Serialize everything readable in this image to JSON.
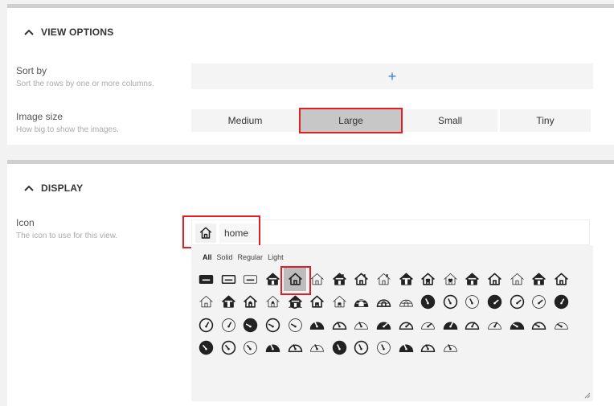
{
  "view_options": {
    "title": "VIEW OPTIONS",
    "sort_by": {
      "label": "Sort by",
      "help": "Sort the rows by one or more columns.",
      "add_label": "+"
    },
    "image_size": {
      "label": "Image size",
      "help": "How big to show the images.",
      "options": [
        "Medium",
        "Large",
        "Small",
        "Tiny"
      ],
      "selected": "Large"
    }
  },
  "display": {
    "title": "DISPLAY",
    "icon": {
      "label": "Icon",
      "help": "The icon to use for this view.",
      "value": "home",
      "preview_icon": "house-outline-icon"
    },
    "picker": {
      "filters": [
        "All",
        "Solid",
        "Regular",
        "Light"
      ],
      "active_filter": "All",
      "icons": [
        "keyboard-solid-icon",
        "keyboard-regular-icon",
        "keyboard-light-icon",
        "house-solid-icon",
        "house-regular-icon",
        "house-light-icon",
        "house-chimney-solid-icon",
        "house-chimney-regular-icon",
        "house-chimney-light-icon",
        "house-window-solid-icon",
        "house-heart-regular-icon",
        "house-heart-light-icon",
        "house-door-solid-icon",
        "house-door-regular-icon",
        "house-door-light-icon",
        "house-roof-solid-icon",
        "house-building-regular-icon",
        "house-building-light-icon",
        "house-user-solid-icon",
        "house-user-regular-icon",
        "house-user-light-icon",
        "house-flood-solid-icon",
        "house-lock-regular-icon",
        "house-lock-light-icon",
        "igloo-solid-icon",
        "igloo-regular-icon",
        "igloo-light-icon",
        "gauge-solid-icon",
        "gauge-regular-icon",
        "gauge-light-icon",
        "gauge-max-solid-icon",
        "gauge-max-regular-icon",
        "gauge-max-light-icon",
        "gauge-high-solid-icon",
        "gauge-high-regular-icon",
        "gauge-high-light-icon",
        "gauge-min-solid-icon",
        "gauge-min-regular-icon",
        "gauge-min-light-icon",
        "gauge-simple-solid-icon",
        "gauge-simple-regular-icon",
        "gauge-simple-light-icon",
        "gauge-simple-max-solid-icon",
        "gauge-simple-max-regular-icon",
        "gauge-simple-max-light-icon",
        "gauge-simple-high-solid-icon",
        "gauge-simple-high-regular-icon",
        "gauge-simple-high-light-icon",
        "gauge-simple-min-solid-icon",
        "gauge-simple-min-regular-icon",
        "gauge-simple-min-light-icon",
        "gauge-low-solid-icon",
        "gauge-low-regular-icon",
        "gauge-low-light-icon",
        "meter-solid-icon",
        "meter-regular-icon",
        "meter-light-icon",
        "gauge-dial-solid-icon",
        "gauge-dial-regular-icon",
        "gauge-dial-light-icon",
        "meter-half-solid-icon",
        "meter-half-regular-icon",
        "meter-half-light-icon"
      ],
      "selected_icon": "house-regular-icon"
    }
  },
  "colors": {
    "highlight": "#e02020",
    "accent": "#3b7fd0",
    "selected_bg": "#c7c7c7"
  }
}
